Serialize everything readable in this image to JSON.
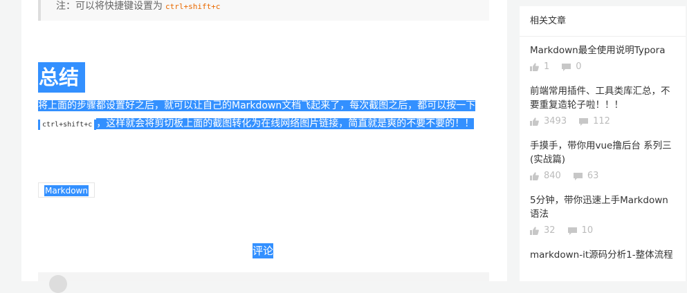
{
  "note": {
    "prefix": "注：可以将快捷键设置为",
    "code": "ctrl+shift+c"
  },
  "section": {
    "heading": "总结",
    "paragraph_part1": "将上面的步骤都设置好之后，就可以让自己的Markdown文档飞起来了，每次截图之后，都可以按一下",
    "paragraph_code": "ctrl+shift+c",
    "paragraph_part2": "，这样就会将剪切板上面的截图转化为在线网络图片链接，简直就是爽的不要不要的！！"
  },
  "tags": [
    "Markdown"
  ],
  "comments": {
    "title": "评论"
  },
  "sidebar": {
    "title": "相关文章",
    "items": [
      {
        "title": "Markdown最全使用说明Typora",
        "likes": "1",
        "comments": "0"
      },
      {
        "title": "前端常用插件、工具类库汇总，不要重复造轮子啦！！！",
        "likes": "3493",
        "comments": "112"
      },
      {
        "title": "手摸手，带你用vue撸后台 系列三(实战篇)",
        "likes": "840",
        "comments": "63"
      },
      {
        "title": "5分钟，带你迅速上手Markdown语法",
        "likes": "32",
        "comments": "10"
      },
      {
        "title": "markdown-it源码分析1-整体流程",
        "likes": "",
        "comments": ""
      }
    ]
  },
  "colors": {
    "selection": "#3390ff",
    "code": "#e96900",
    "muted": "#bbbbbb",
    "page_bg": "#f4f5f5"
  },
  "icons": {
    "like": "thumbs-up-icon",
    "comment": "comment-bubble-icon"
  }
}
